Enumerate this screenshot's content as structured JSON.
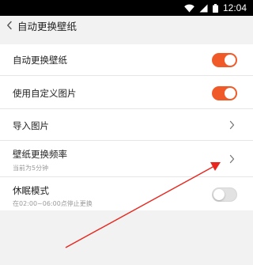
{
  "status_bar": {
    "time": "12:04",
    "icons": [
      "wifi-icon",
      "signal-icon",
      "battery-icon"
    ]
  },
  "header": {
    "back_icon": "chevron-left-icon",
    "title": "自动更换壁纸"
  },
  "settings": {
    "items": [
      {
        "label": "自动更换壁纸",
        "control": "toggle",
        "enabled": true
      },
      {
        "label": "使用自定义图片",
        "control": "toggle",
        "enabled": true
      },
      {
        "label": "导入图片",
        "control": "chevron"
      },
      {
        "label": "壁纸更换频率",
        "subtitle": "当前为5分钟",
        "control": "chevron"
      },
      {
        "label": "休眠模式",
        "subtitle": "在02:00~06:00点停止更换",
        "control": "toggle",
        "enabled": false
      }
    ]
  },
  "colors": {
    "accent": "#f05a28",
    "toggle_off": "#e2e2e2",
    "background": "#f2f2f2",
    "card": "#ffffff",
    "annotation_arrow": "#e8261e"
  }
}
